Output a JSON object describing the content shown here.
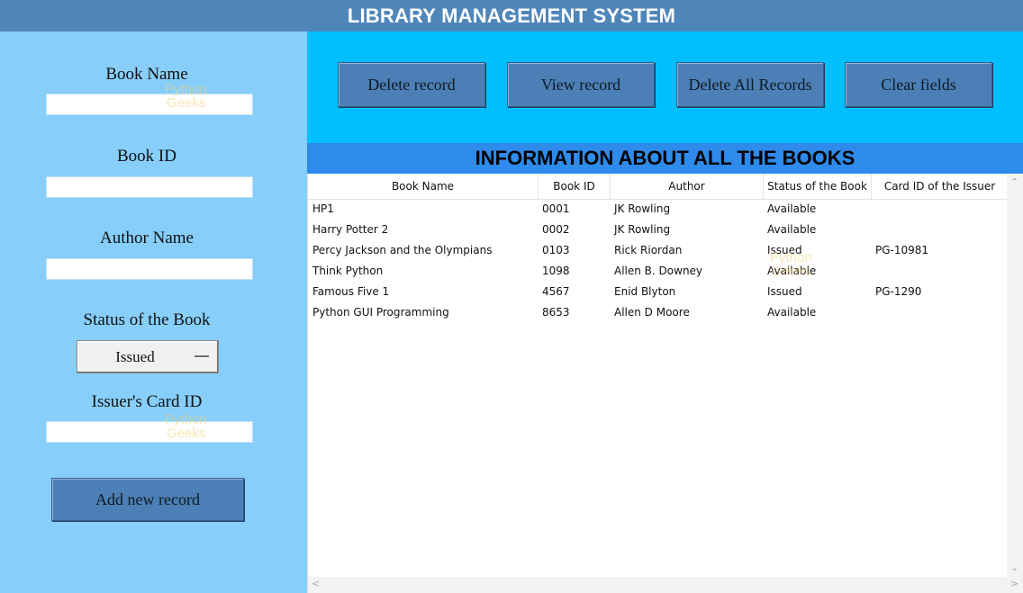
{
  "window": {
    "title": "LIBRARY MANAGEMENT SYSTEM"
  },
  "form": {
    "book_name_label": "Book Name",
    "book_name_value": "",
    "book_id_label": "Book ID",
    "book_id_value": "",
    "author_label": "Author Name",
    "author_value": "",
    "status_label": "Status of the Book",
    "status_value": "Issued",
    "card_label": "Issuer's Card ID",
    "card_value": "",
    "add_button": "Add new record"
  },
  "toolbar": {
    "delete_record": "Delete record",
    "view_record": "View record",
    "delete_all": "Delete All Records",
    "clear_fields": "Clear fields"
  },
  "table": {
    "title": "INFORMATION ABOUT ALL THE BOOKS",
    "columns": [
      "Book Name",
      "Book ID",
      "Author",
      "Status of the Book",
      "Card ID of the Issuer"
    ],
    "rows": [
      [
        "HP1",
        "0001",
        "JK Rowling",
        "Available",
        ""
      ],
      [
        "Harry Potter 2",
        "0002",
        "JK Rowling",
        "Available",
        ""
      ],
      [
        "Percy Jackson and the Olympians",
        "0103",
        "Rick Riordan",
        "Issued",
        "PG-10981"
      ],
      [
        "Think Python",
        "1098",
        "Allen B. Downey",
        "Available",
        ""
      ],
      [
        "Famous Five 1",
        "4567",
        "Enid Blyton",
        "Issued",
        "PG-1290"
      ],
      [
        "Python GUI Programming",
        "8653",
        "Allen D Moore",
        "Available",
        ""
      ]
    ]
  },
  "watermark": {
    "line1": "Python",
    "line2": "Geeks"
  },
  "colors": {
    "title_bar": "#4f86ba",
    "left_panel": "#87cefa",
    "toolbar": "#00bfff",
    "table_title": "#2e8bec",
    "button": "#4c7fb5"
  }
}
